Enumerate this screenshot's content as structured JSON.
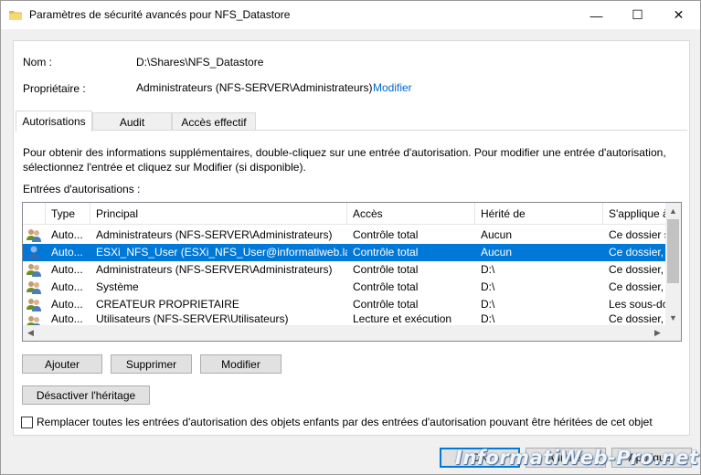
{
  "window": {
    "title": "Paramètres de sécurité avancés pour NFS_Datastore",
    "minimize": "—",
    "maximize": "☐",
    "close": "✕"
  },
  "object": {
    "name_label": "Nom :",
    "name_value": "D:\\Shares\\NFS_Datastore",
    "owner_label": "Propriétaire :",
    "owner_value": "Administrateurs (NFS-SERVER\\Administrateurs)",
    "owner_change": "Modifier"
  },
  "tabs": [
    {
      "label": "Autorisations",
      "active": true
    },
    {
      "label": "Audit",
      "active": false
    },
    {
      "label": "Accès effectif",
      "active": false
    }
  ],
  "info": {
    "line1": "Pour obtenir des informations supplémentaires, double-cliquez sur une entrée d'autorisation. Pour modifier une entrée d'autorisation,",
    "line2": "sélectionnez l'entrée et cliquez sur Modifier (si disponible)."
  },
  "entries_label": "Entrées d'autorisations :",
  "table": {
    "columns": [
      "Type",
      "Principal",
      "Accès",
      "Hérité de",
      "S'applique à"
    ],
    "rows": [
      {
        "icon": "users-group-icon",
        "type": "Auto...",
        "principal": "Administrateurs (NFS-SERVER\\Administrateurs)",
        "access": "Contrôle total",
        "inherited": "Aucun",
        "applies": "Ce dossier seu",
        "selected": false
      },
      {
        "icon": "user-icon",
        "type": "Auto...",
        "principal": "ESXi_NFS_User (ESXi_NFS_User@informatiweb.lan)",
        "access": "Contrôle total",
        "inherited": "Aucun",
        "applies": "Ce dossier, le",
        "selected": true
      },
      {
        "icon": "users-group-icon",
        "type": "Auto...",
        "principal": "Administrateurs (NFS-SERVER\\Administrateurs)",
        "access": "Contrôle total",
        "inherited": "D:\\",
        "applies": "Ce dossier, le",
        "selected": false
      },
      {
        "icon": "users-group-icon",
        "type": "Auto...",
        "principal": "Système",
        "access": "Contrôle total",
        "inherited": "D:\\",
        "applies": "Ce dossier, le",
        "selected": false
      },
      {
        "icon": "users-group-icon",
        "type": "Auto...",
        "principal": "CREATEUR PROPRIETAIRE",
        "access": "Contrôle total",
        "inherited": "D:\\",
        "applies": "Les sous-doss",
        "selected": false
      },
      {
        "icon": "users-group-icon",
        "type": "Auto...",
        "principal": "Utilisateurs (NFS-SERVER\\Utilisateurs)",
        "access": "Lecture et exécution",
        "inherited": "D:\\",
        "applies": "Ce dossier, le",
        "selected": false
      }
    ]
  },
  "buttons": {
    "add": "Ajouter",
    "remove": "Supprimer",
    "edit": "Modifier",
    "disable_inheritance": "Désactiver l'héritage"
  },
  "replace_checkbox": {
    "label": "Remplacer toutes les entrées d'autorisation des objets enfants par des entrées d'autorisation pouvant être héritées de cet objet",
    "checked": false
  },
  "footer": {
    "ok": "OK",
    "cancel": "Annuler",
    "apply": "Appliquer"
  },
  "watermark": "InformatiWeb-Pro.net",
  "colors": {
    "selection": "#0078d7",
    "link": "#0066cc"
  }
}
